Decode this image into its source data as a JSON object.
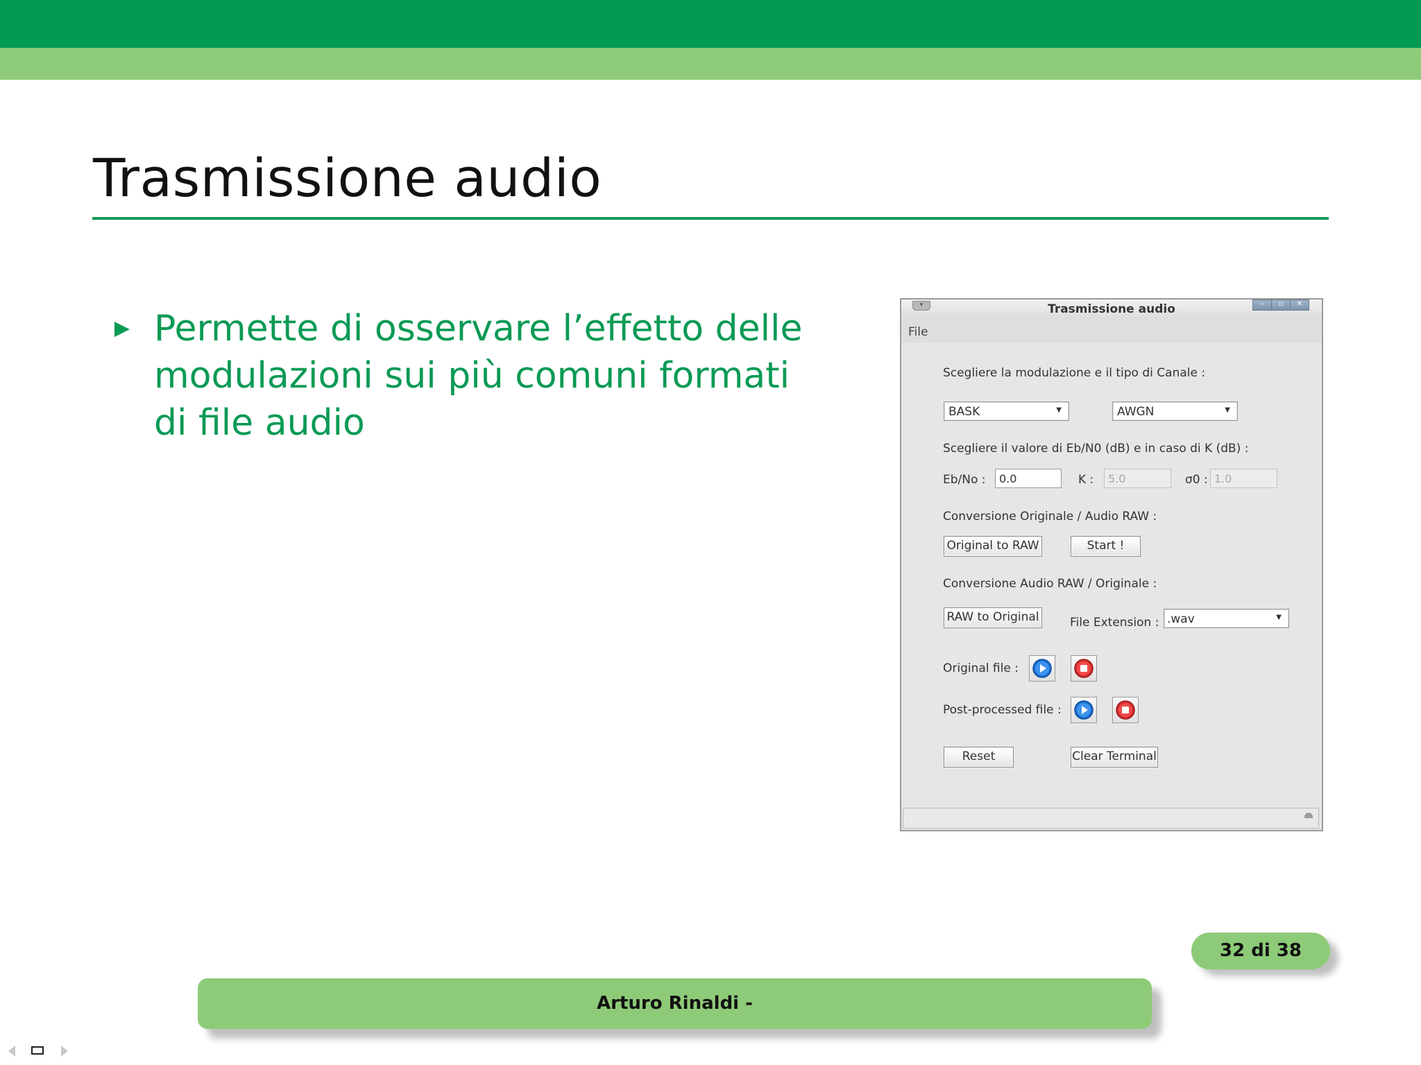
{
  "slide": {
    "title": "Trasmissione audio",
    "bullet": "Permette di osservare l’effetto delle modulazioni sui più comuni formati di file audio",
    "page": "32 di 38",
    "footer": "Arturo Rinaldi -"
  },
  "theme": {
    "dark_green": "#009a52",
    "light_green": "#8ecb78",
    "accent_text": "#0a9a55"
  },
  "app": {
    "title": "Trasmissione audio",
    "menu": {
      "file": "File"
    },
    "modulation_prompt": "Scegliere la modulazione e il tipo di Canale :",
    "modulation": "BASK",
    "channel": "AWGN",
    "value_prompt": "Scegliere il valore di Eb/N0 (dB) e in caso di K (dB) :",
    "ebno_label": "Eb/No :",
    "ebno_value": "0.0",
    "k_label": "K :",
    "k_value": "5.0",
    "sigma_label": "σ0 :",
    "sigma_value": "1.0",
    "conv1_label": "Conversione Originale / Audio RAW :",
    "original_to_raw": "Original to RAW",
    "start": "Start !",
    "conv2_label": "Conversione Audio RAW / Originale :",
    "raw_to_original": "RAW to Original",
    "file_ext_label": "File Extension :",
    "file_ext_value": ".wav",
    "original_file_label": "Original file :",
    "post_file_label": "Post-processed file :",
    "reset": "Reset",
    "clear_terminal": "Clear Terminal"
  }
}
